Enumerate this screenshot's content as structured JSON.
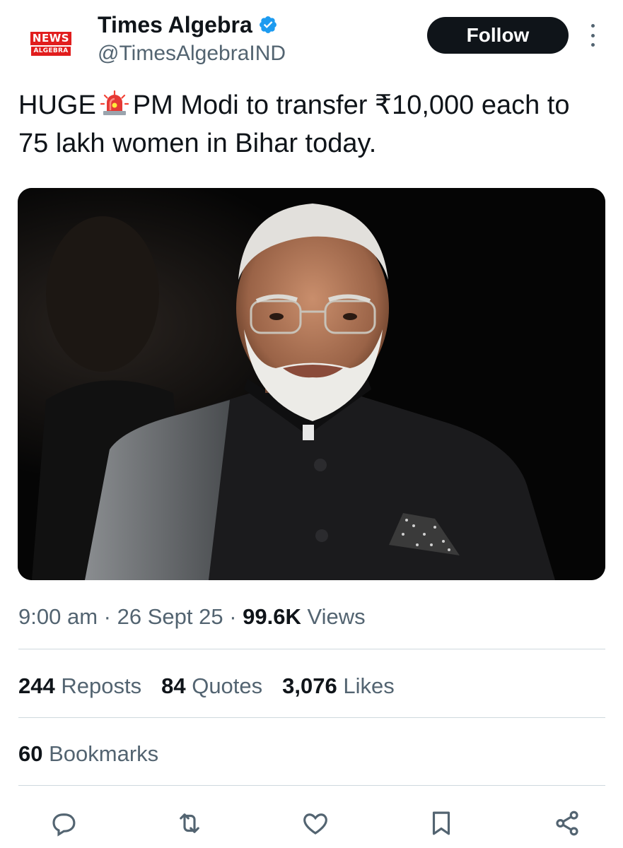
{
  "account": {
    "logo_top": "NEWS",
    "logo_bottom": "ALGEBRA",
    "display_name": "Times Algebra",
    "handle": "@TimesAlgebraIND",
    "verified_icon": "verified-badge-icon"
  },
  "follow_label": "Follow",
  "more_icon": "more-options-icon",
  "tweet": {
    "text_before": "HUGE",
    "emoji": "siren-icon",
    "text_after": "PM Modi to transfer ₹10,000 each to 75 lakh women in Bihar today."
  },
  "media": {
    "icon": "photo-man-in-dark-jacket"
  },
  "meta": {
    "time": "9:00 am",
    "sep1": "·",
    "date": "26 Sept 25",
    "sep2": "·",
    "views_count": "99.6K",
    "views_label": "Views"
  },
  "stats": {
    "reposts_count": "244",
    "reposts_label": "Reposts",
    "quotes_count": "84",
    "quotes_label": "Quotes",
    "likes_count": "3,076",
    "likes_label": "Likes",
    "bookmarks_count": "60",
    "bookmarks_label": "Bookmarks"
  },
  "actions": [
    "reply-icon",
    "repost-icon",
    "like-icon",
    "bookmark-icon",
    "share-icon"
  ],
  "colors": {
    "text": "#0f1419",
    "secondary": "#536471",
    "divider": "#cfd9de",
    "verified": "#1d9bf0",
    "logo_red": "#e11d1d"
  }
}
